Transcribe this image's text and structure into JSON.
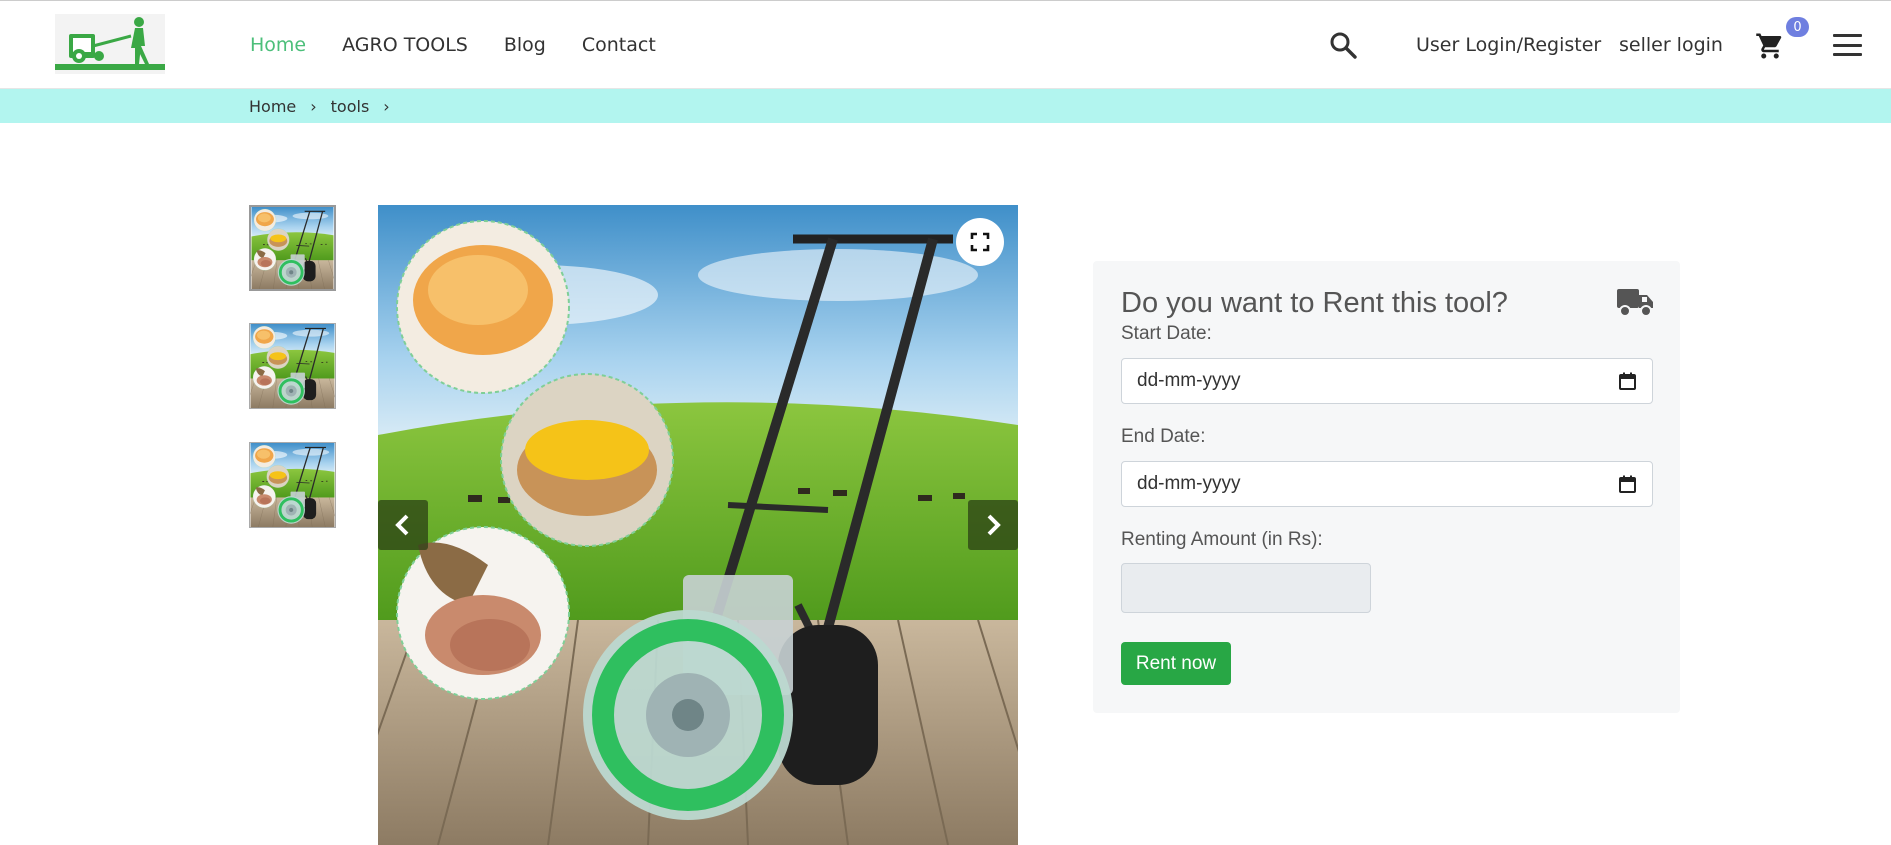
{
  "header": {
    "logo_icon": "farmer-with-seeder-logo",
    "nav": [
      {
        "label": "Home",
        "active": true
      },
      {
        "label": "AGRO TOOLS",
        "active": false
      },
      {
        "label": "Blog",
        "active": false
      },
      {
        "label": "Contact",
        "active": false
      }
    ],
    "search_icon": "search-icon",
    "user_login_label": "User Login/Register",
    "seller_login_label": "seller login",
    "cart_icon": "shopping-cart-icon",
    "cart_count": "0",
    "menu_icon": "hamburger-menu-icon",
    "active_color": "#4cbf7a"
  },
  "breadcrumb": {
    "items": [
      "Home",
      "tools"
    ],
    "separator": "›",
    "bar_color": "#b2f5ef"
  },
  "gallery": {
    "thumbnail_count": 3,
    "selected_thumbnail": 1,
    "main_image": "hand-push seed planter with soybeans, corn kernels and peanuts on a wooden deck in front of a green pasture",
    "expand_icon": "fullscreen-icon",
    "prev_icon": "chevron-left-icon",
    "next_icon": "chevron-right-icon"
  },
  "rent_panel": {
    "title": "Do you want to Rent this tool?",
    "truck_icon": "delivery-truck-icon",
    "start_date_label": "Start Date:",
    "start_date_placeholder": "dd-mm-yyyy",
    "end_date_label": "End Date:",
    "end_date_placeholder": "dd-mm-yyyy",
    "calendar_icon": "calendar-icon",
    "amount_label": "Renting Amount (in Rs):",
    "amount_value": "",
    "rent_button": "Rent now",
    "button_color": "#28a745"
  }
}
